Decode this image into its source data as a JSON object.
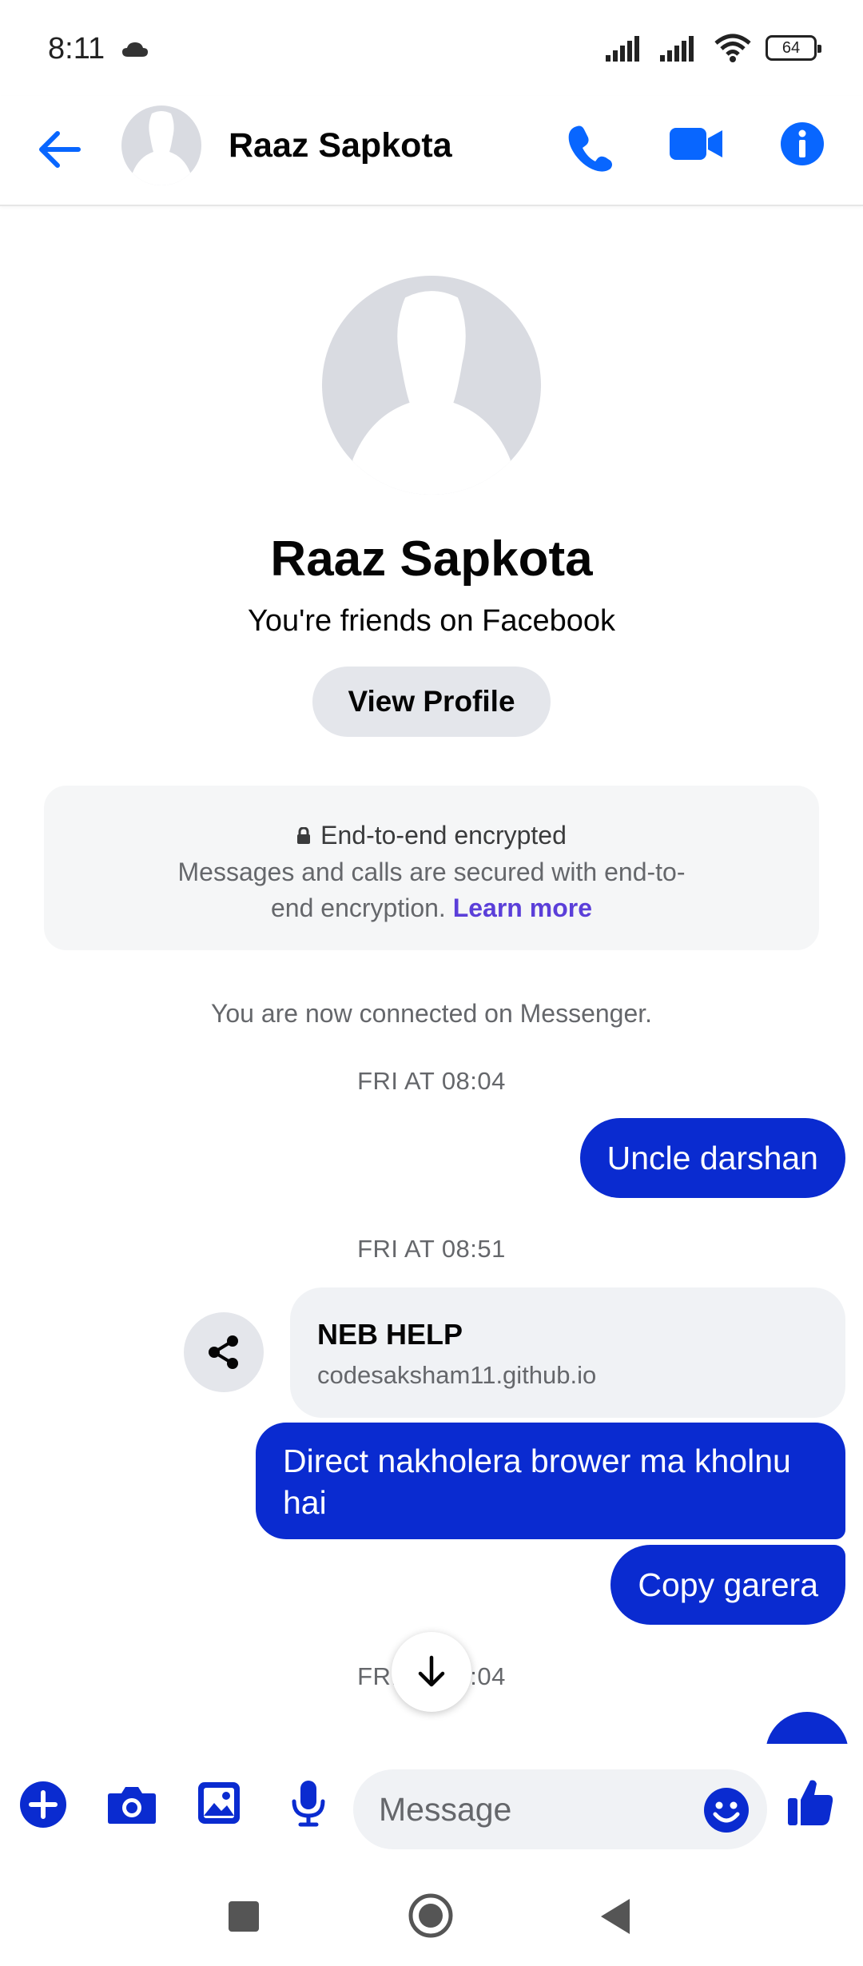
{
  "status_bar": {
    "time": "8:11",
    "battery": "64"
  },
  "header": {
    "contact_name": "Raaz Sapkota"
  },
  "profile": {
    "name": "Raaz Sapkota",
    "relationship": "You're friends on Facebook",
    "view_profile_label": "View Profile"
  },
  "encryption": {
    "title": "End-to-end encrypted",
    "body": "Messages and calls are secured with end-to-end encryption.",
    "learn_more": "Learn more"
  },
  "conversation": {
    "connected_notice": "You are now connected on Messenger.",
    "timestamps": [
      "FRI AT 08:04",
      "FRI AT 08:51",
      "FRI AT 09:04"
    ],
    "messages": [
      {
        "sender": "me",
        "text": "Uncle darshan"
      },
      {
        "sender": "them",
        "type": "link",
        "title": "NEB HELP",
        "url": "codesaksham11.github.io"
      },
      {
        "sender": "me",
        "text": "Direct nakholera brower ma kholnu hai"
      },
      {
        "sender": "me",
        "text": "Copy garera"
      }
    ]
  },
  "composer": {
    "placeholder": "Message"
  },
  "colors": {
    "accent": "#0866ff",
    "outgoing_bubble": "#0a2bd0",
    "link": "#5b3fd9"
  }
}
